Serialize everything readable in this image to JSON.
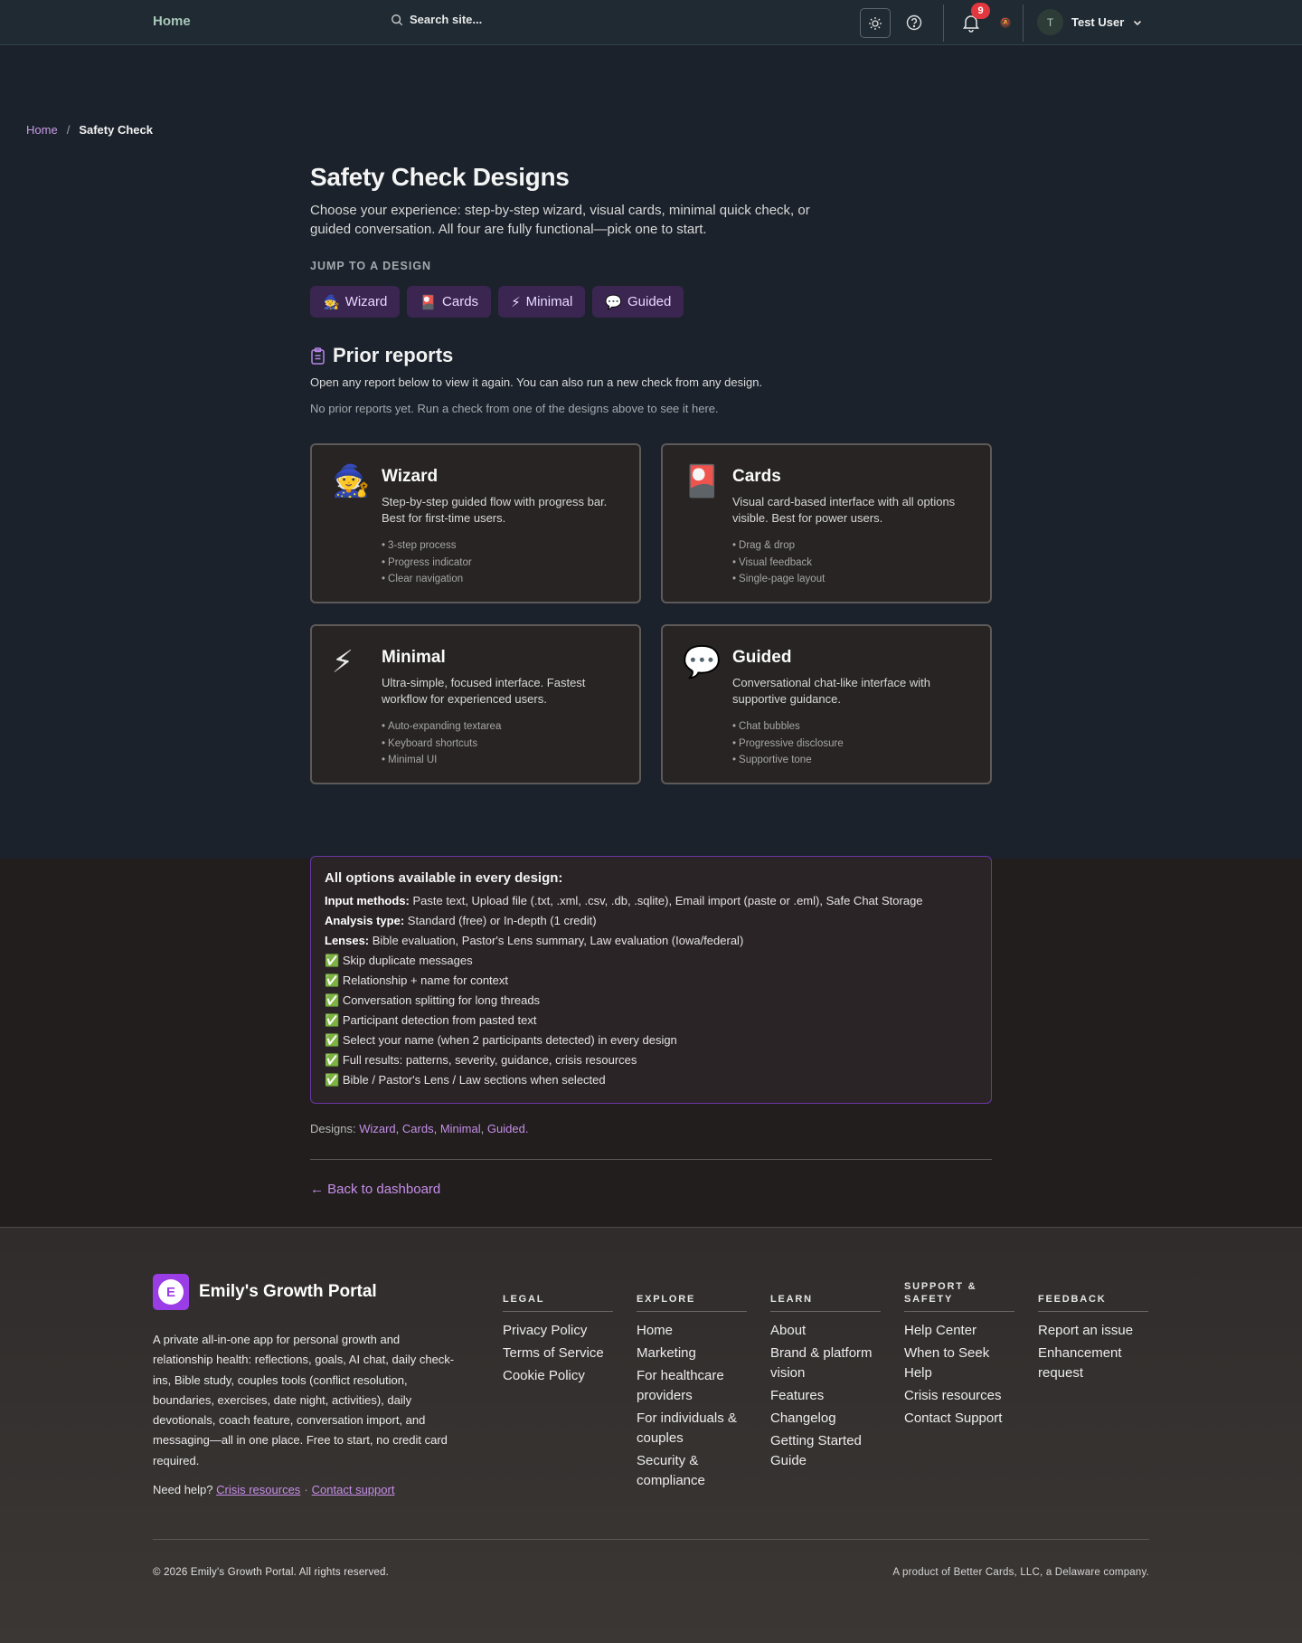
{
  "header": {
    "home": "Home",
    "search_placeholder": "Search site...",
    "notifications_count": "9",
    "user_initial": "T",
    "user_name": "Test User"
  },
  "breadcrumb": {
    "home": "Home",
    "separator": "/",
    "current": "Safety Check"
  },
  "page": {
    "title": "Safety Check Designs",
    "intro": "Choose your experience: step-by-step wizard, visual cards, minimal quick check, or guided conversation. All four are fully functional—pick one to start.",
    "jump_label": "JUMP TO A DESIGN",
    "jump_buttons": [
      {
        "icon": "🧙",
        "label": "Wizard"
      },
      {
        "icon": "🎴",
        "label": "Cards"
      },
      {
        "icon": "⚡",
        "label": "Minimal"
      },
      {
        "icon": "💬",
        "label": "Guided"
      }
    ],
    "prior_title": "Prior reports",
    "prior_desc": "Open any report below to view it again. You can also run a new check from any design.",
    "prior_empty": "No prior reports yet. Run a check from one of the designs above to see it here."
  },
  "designs": [
    {
      "icon": "🧙",
      "title": "Wizard",
      "desc": "Step-by-step guided flow with progress bar. Best for first-time users.",
      "features": [
        "3-step process",
        "Progress indicator",
        "Clear navigation"
      ]
    },
    {
      "icon": "🎴",
      "title": "Cards",
      "desc": "Visual card-based interface with all options visible. Best for power users.",
      "features": [
        "Drag & drop",
        "Visual feedback",
        "Single-page layout"
      ]
    },
    {
      "icon": "⚡",
      "title": "Minimal",
      "desc": "Ultra-simple, focused interface. Fastest workflow for experienced users.",
      "features": [
        "Auto-expanding textarea",
        "Keyboard shortcuts",
        "Minimal UI"
      ]
    },
    {
      "icon": "💬",
      "title": "Guided",
      "desc": "Conversational chat-like interface with supportive guidance.",
      "features": [
        "Chat bubbles",
        "Progressive disclosure",
        "Supportive tone"
      ]
    }
  ],
  "options": {
    "title": "All options available in every design:",
    "input_label": "Input methods:",
    "input_value": "Paste text, Upload file (.txt, .xml, .csv, .db, .sqlite), Email import (paste or .eml), Safe Chat Storage",
    "analysis_label": "Analysis type:",
    "analysis_value": "Standard (free) or In-depth (1 credit)",
    "lenses_label": "Lenses:",
    "lenses_value": "Bible evaluation, Pastor's Lens summary, Law evaluation (Iowa/federal)",
    "check_icon": "✅",
    "checks": [
      "Skip duplicate messages",
      "Relationship + name for context",
      "Conversation splitting for long threads",
      "Participant detection from pasted text",
      "Select your name (when 2 participants detected) in every design",
      "Full results: patterns, severity, guidance, crisis resources",
      "Bible / Pastor's Lens / Law sections when selected"
    ]
  },
  "designs_line": {
    "prefix": "Designs:",
    "links": [
      "Wizard",
      "Cards",
      "Minimal",
      "Guided"
    ],
    "sep": ",",
    "end": "."
  },
  "back_link": "← Back to dashboard",
  "footer": {
    "brand_initial": "E",
    "brand_name": "Emily's Growth Portal",
    "desc": "A private all-in-one app for personal growth and relationship health: reflections, goals, AI chat, daily check-ins, Bible study, couples tools (conflict resolution, boundaries, exercises, date night, activities), daily devotionals, coach feature, conversation import, and messaging—all in one place. Free to start, no credit card required.",
    "help_prefix": "Need help?",
    "help_crisis": "Crisis resources",
    "help_dot": "·",
    "help_contact": "Contact support",
    "columns": [
      {
        "heading": "LEGAL",
        "links": [
          "Privacy Policy",
          "Terms of Service",
          "Cookie Policy"
        ]
      },
      {
        "heading": "EXPLORE",
        "links": [
          "Home",
          "Marketing",
          "For healthcare providers",
          "For individuals & couples",
          "Security & compliance"
        ]
      },
      {
        "heading": "LEARN",
        "links": [
          "About",
          "Brand & platform vision",
          "Features",
          "Changelog",
          "Getting Started Guide"
        ]
      },
      {
        "heading": "SUPPORT & SAFETY",
        "links": [
          "Help Center",
          "When to Seek Help",
          "Crisis resources",
          "Contact Support"
        ]
      },
      {
        "heading": "FEEDBACK",
        "links": [
          "Report an issue",
          "Enhancement request"
        ]
      }
    ],
    "copyright": "© 2026 Emily's Growth Portal. All rights reserved.",
    "product": "A product of Better Cards, LLC, a Delaware company."
  },
  "colors": {
    "accent": "#c58ee8",
    "brand": "#9b3de6",
    "badge": "#e0383e"
  }
}
